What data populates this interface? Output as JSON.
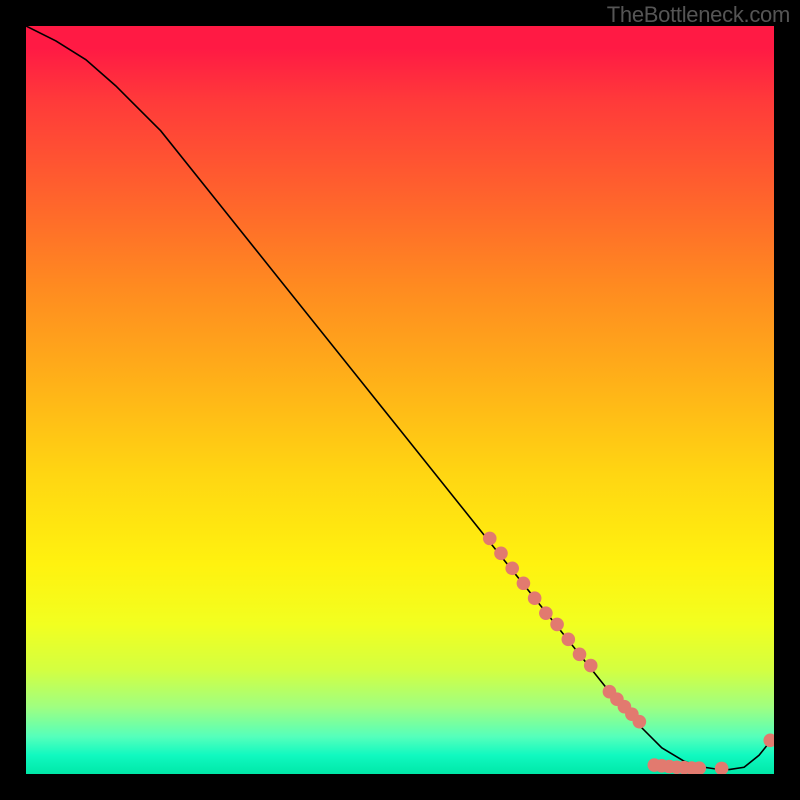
{
  "watermark": "TheBottleneck.com",
  "chart_data": {
    "type": "line",
    "title": "",
    "xlabel": "",
    "ylabel": "",
    "xlim": [
      0,
      100
    ],
    "ylim": [
      0,
      100
    ],
    "grid": false,
    "series": [
      {
        "name": "curve",
        "x": [
          0,
          4,
          8,
          12,
          18,
          26,
          34,
          42,
          50,
          58,
          64,
          70,
          74,
          78,
          82,
          85,
          88,
          90,
          92,
          94,
          96,
          98,
          100
        ],
        "values": [
          100,
          98,
          95.5,
          92,
          86,
          76,
          66,
          56,
          46,
          36,
          28.5,
          21,
          16,
          11,
          6.5,
          3.5,
          1.7,
          1.0,
          0.7,
          0.6,
          0.9,
          2.5,
          5.0
        ]
      }
    ],
    "scatter_points": {
      "name": "markers",
      "color": "#e27a6f",
      "x": [
        62,
        63.5,
        65,
        66.5,
        68,
        69.5,
        71,
        72.5,
        74,
        75.5,
        78,
        79,
        80,
        81,
        82,
        84,
        85,
        86,
        87,
        88,
        89,
        90,
        93,
        99.5
      ],
      "y": [
        31.5,
        29.5,
        27.5,
        25.5,
        23.5,
        21.5,
        20,
        18,
        16,
        14.5,
        11,
        10,
        9,
        8,
        7,
        1.2,
        1.1,
        1.0,
        0.9,
        0.85,
        0.8,
        0.78,
        0.75,
        4.5
      ]
    },
    "background": {
      "type": "vertical-gradient",
      "top": "#ff1a44",
      "bottom": "#00e8a8"
    }
  }
}
